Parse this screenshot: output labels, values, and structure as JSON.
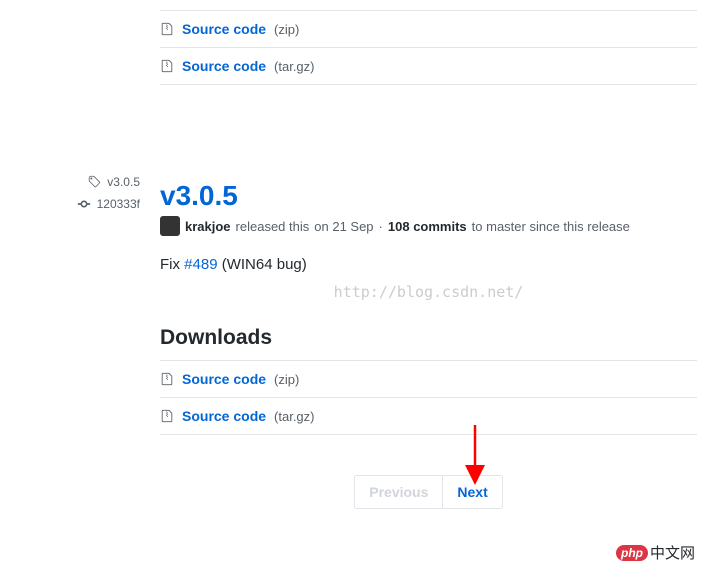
{
  "sidebar": {
    "tag": "v3.0.5",
    "commit": "120333f"
  },
  "top_downloads": [
    {
      "name": "Source code",
      "ext": "(zip)"
    },
    {
      "name": "Source code",
      "ext": "(tar.gz)"
    }
  ],
  "release": {
    "title": "v3.0.5",
    "author": "krakjoe",
    "released_text": "released this",
    "date": "on 21 Sep",
    "commits_count": "108 commits",
    "commits_suffix": "to master since this release",
    "fix_prefix": "Fix",
    "fix_issue": "#489",
    "fix_suffix": "(WIN64 bug)"
  },
  "watermark": "http://blog.csdn.net/",
  "downloads_heading": "Downloads",
  "release_downloads": [
    {
      "name": "Source code",
      "ext": "(zip)"
    },
    {
      "name": "Source code",
      "ext": "(tar.gz)"
    }
  ],
  "pagination": {
    "previous": "Previous",
    "next": "Next"
  },
  "footer": {
    "badge": "php",
    "text": "中文网"
  }
}
